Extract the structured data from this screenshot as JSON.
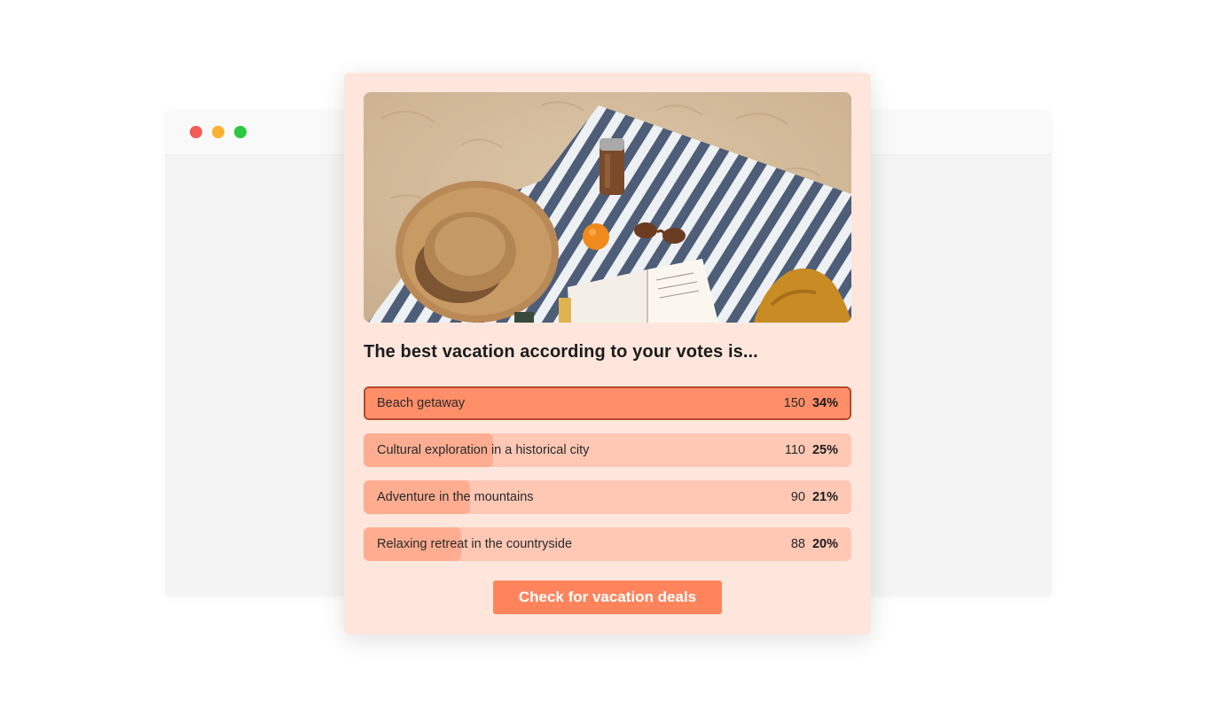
{
  "window": {
    "controls": [
      {
        "name": "close",
        "color": "#f25c54"
      },
      {
        "name": "minimize",
        "color": "#f9b12f"
      },
      {
        "name": "maximize",
        "color": "#2ac840"
      }
    ]
  },
  "poll": {
    "image": "beach-scene-image",
    "title": "The best vacation according to your votes is...",
    "options": [
      {
        "label": "Beach getaway",
        "votes": "150",
        "percent": "34%",
        "share": 1.0,
        "selected": true
      },
      {
        "label": "Cultural exploration in a historical city",
        "votes": "110",
        "percent": "25%",
        "share": 0.265,
        "selected": false
      },
      {
        "label": "Adventure in the mountains",
        "votes": "90",
        "percent": "21%",
        "share": 0.218,
        "selected": false
      },
      {
        "label": "Relaxing retreat in the countryside",
        "votes": "88",
        "percent": "20%",
        "share": 0.2,
        "selected": false
      }
    ],
    "cta_label": "Check for vacation deals"
  },
  "colors": {
    "accent": "#ff845c",
    "card_background": "#ffe6dd",
    "bar_track": "#ffc8b5",
    "bar_fill": "#ffad91",
    "bar_fill_selected": "#ff8e69",
    "selected_border": "#b3492a"
  }
}
